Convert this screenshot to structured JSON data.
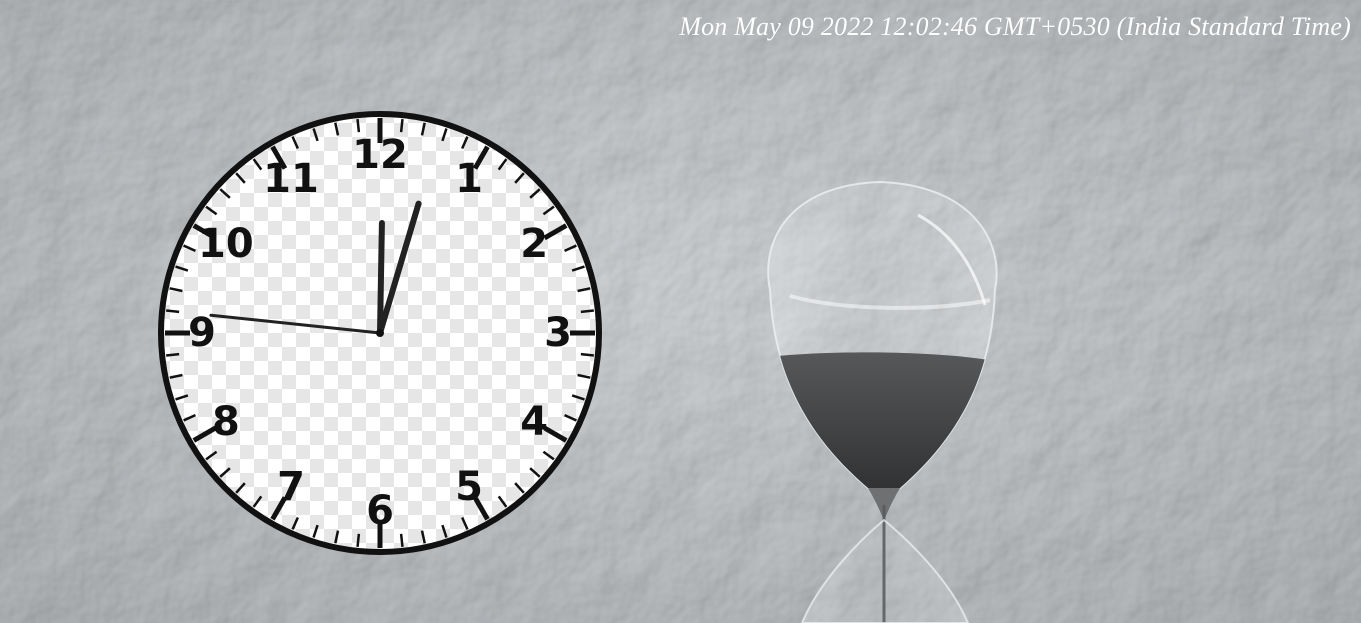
{
  "header": {
    "datetime_text": "Mon May 09 2022 12:02:46 GMT+0530 (India Standard Time)"
  },
  "clock": {
    "numerals": [
      "12",
      "1",
      "2",
      "3",
      "4",
      "5",
      "6",
      "7",
      "8",
      "9",
      "10",
      "11"
    ],
    "time": {
      "hours": 12,
      "minutes": 2,
      "seconds": 46
    },
    "face_pattern": "transparency-checkerboard",
    "hand_color": "#222222",
    "ring_color": "#111111"
  },
  "background": {
    "texture": "textured-stucco-wall",
    "wall_color": "#c3c6c8",
    "object": "hourglass",
    "sand_color": "#3c3d3f"
  }
}
